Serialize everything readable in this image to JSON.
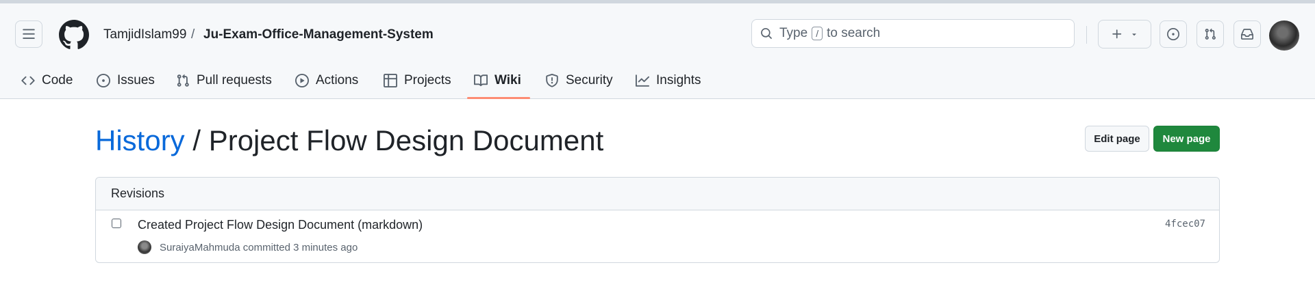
{
  "header": {
    "owner": "TamjidIslam99",
    "separator": "/",
    "repo": "Ju-Exam-Office-Management-System",
    "search": {
      "prefix": "Type",
      "key": "/",
      "suffix": "to search"
    },
    "icons": [
      "hamburger-icon",
      "github-logo",
      "search-icon",
      "plus-icon",
      "chevron-down-icon",
      "issue-icon",
      "pull-request-icon",
      "inbox-icon"
    ]
  },
  "tabs": [
    {
      "label": "Code",
      "icon": "code-icon"
    },
    {
      "label": "Issues",
      "icon": "issue-icon"
    },
    {
      "label": "Pull requests",
      "icon": "pull-request-icon"
    },
    {
      "label": "Actions",
      "icon": "play-icon"
    },
    {
      "label": "Projects",
      "icon": "table-icon"
    },
    {
      "label": "Wiki",
      "icon": "book-icon",
      "active": true
    },
    {
      "label": "Security",
      "icon": "shield-icon"
    },
    {
      "label": "Insights",
      "icon": "graph-icon"
    }
  ],
  "page": {
    "history_link": "History",
    "separator": "/",
    "title": "Project Flow Design Document",
    "edit_label": "Edit page",
    "new_label": "New page"
  },
  "revisions": {
    "heading": "Revisions",
    "items": [
      {
        "title": "Created Project Flow Design Document (markdown)",
        "sha": "4fcec07",
        "author": "SuraiyaMahmuda",
        "action": "committed",
        "time": "3 minutes ago"
      }
    ]
  },
  "colors": {
    "link": "#0969da",
    "primary": "#1f883d",
    "active_tab": "#fd8c73"
  }
}
